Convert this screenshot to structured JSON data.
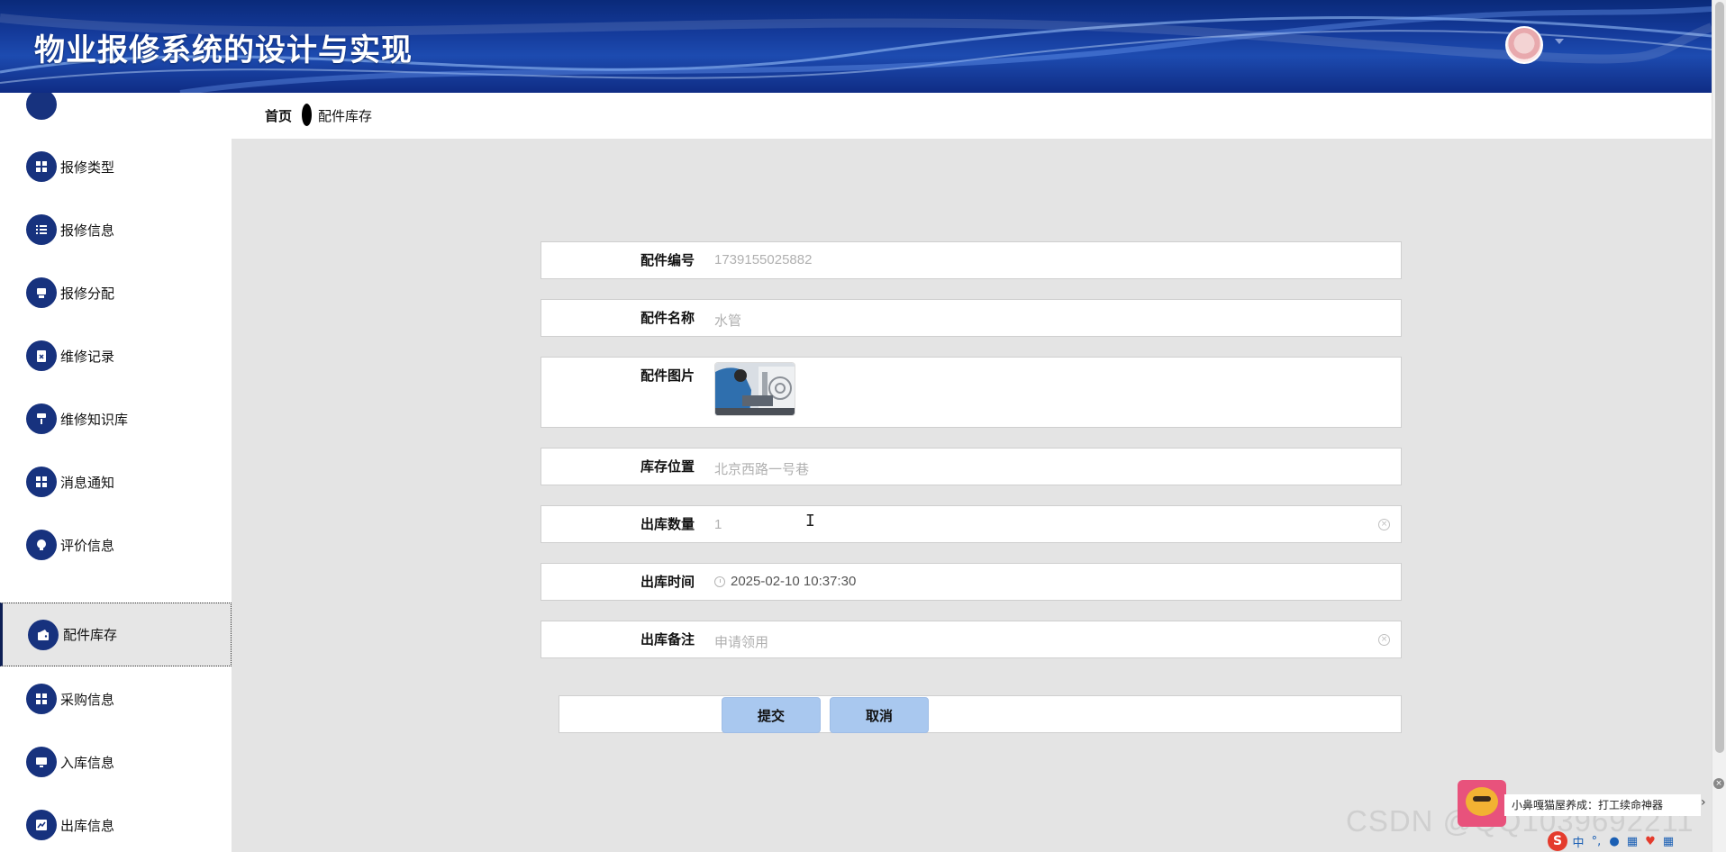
{
  "app": {
    "title": "物业报修系统的设计与实现"
  },
  "breadcrumb": {
    "home": "首页",
    "current": "配件库存"
  },
  "sidebar": {
    "items": [
      {
        "label": "报修类型",
        "icon": "grid-icon"
      },
      {
        "label": "报修信息",
        "icon": "list-icon"
      },
      {
        "label": "报修分配",
        "icon": "printer-icon"
      },
      {
        "label": "维修记录",
        "icon": "clipboard-icon"
      },
      {
        "label": "维修知识库",
        "icon": "paint-roller-icon"
      },
      {
        "label": "消息通知",
        "icon": "grid-icon"
      },
      {
        "label": "评价信息",
        "icon": "lightbulb-icon"
      },
      {
        "label": "配件库存",
        "icon": "wallet-icon",
        "active": true
      },
      {
        "label": "采购信息",
        "icon": "grid-icon"
      },
      {
        "label": "入库信息",
        "icon": "monitor-icon"
      },
      {
        "label": "出库信息",
        "icon": "chart-icon"
      }
    ]
  },
  "form": {
    "part_code": {
      "label": "配件编号",
      "value": "1739155025882"
    },
    "part_name": {
      "label": "配件名称",
      "value": "水管"
    },
    "part_image": {
      "label": "配件图片"
    },
    "stock_location": {
      "label": "库存位置",
      "value": "北京西路一号巷"
    },
    "out_quantity": {
      "label": "出库数量",
      "value": "1"
    },
    "out_time": {
      "label": "出库时间",
      "value": "2025-02-10 10:37:30"
    },
    "out_remark": {
      "label": "出库备注",
      "value": "申请领用"
    }
  },
  "buttons": {
    "submit": "提交",
    "cancel": "取消"
  },
  "overlays": {
    "notification": "小鼻嘎猫屋养成：打工续命神器",
    "watermark": "CSDN @QQ1039692211",
    "ime_logo": "S",
    "ime_lang": "中"
  },
  "colors": {
    "header": "#143a9a",
    "accent": "#17327e",
    "button": "#a9c8ef",
    "page_bg": "#e4e4e4"
  }
}
